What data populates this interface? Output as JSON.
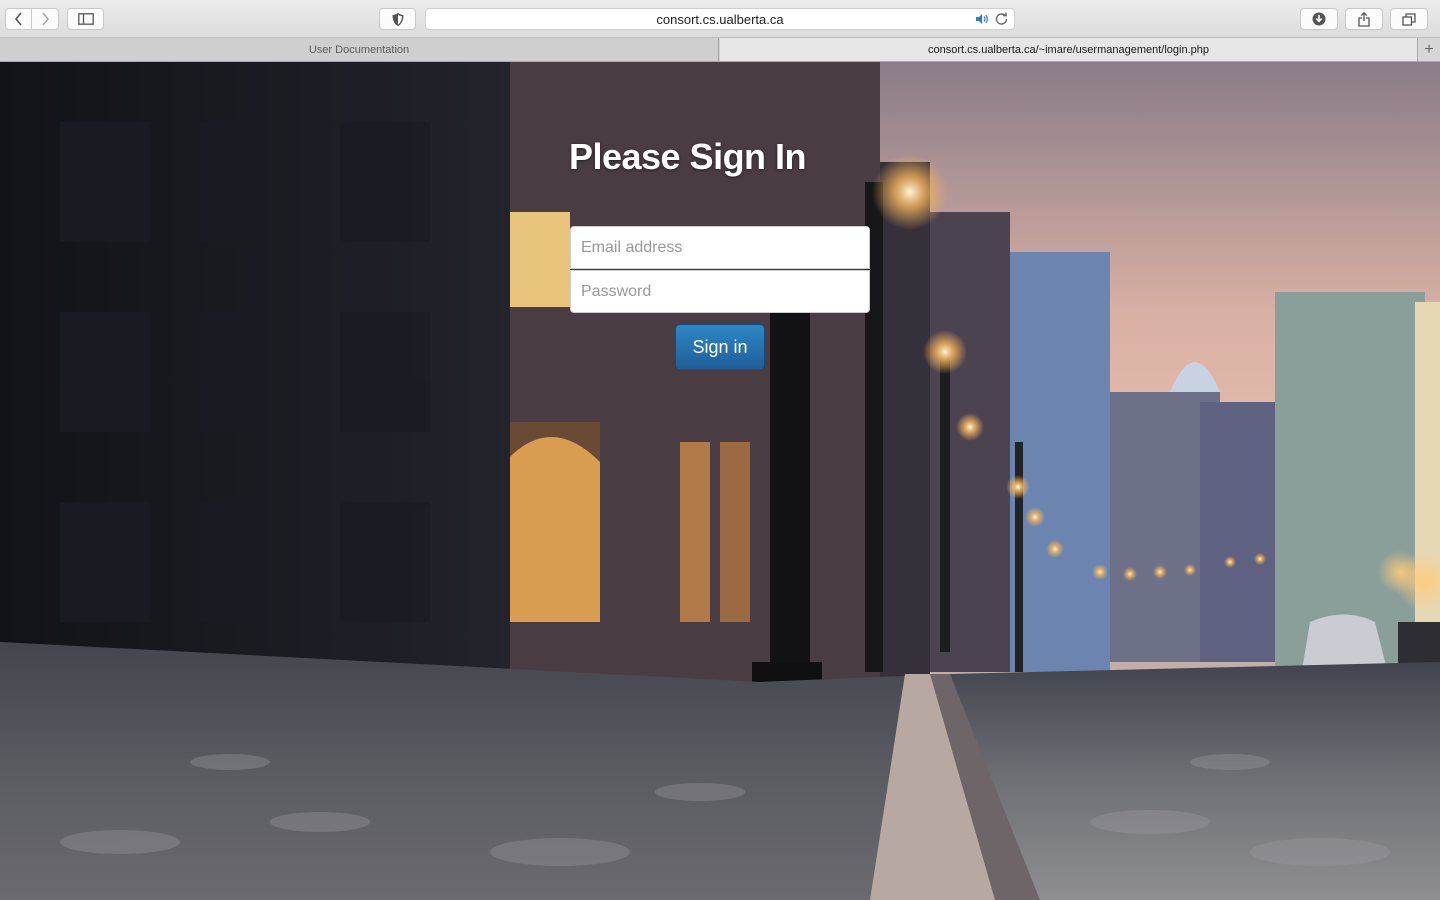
{
  "browser": {
    "address": "consort.cs.ualberta.ca",
    "tabs": [
      {
        "label": "User Documentation",
        "active": false
      },
      {
        "label": "consort.cs.ualberta.ca/~imare/usermanagement/login.php",
        "active": true
      }
    ],
    "new_tab_glyph": "+"
  },
  "login": {
    "title": "Please Sign In",
    "email_placeholder": "Email address",
    "password_placeholder": "Password",
    "email_value": "",
    "password_value": "",
    "submit_label": "Sign in"
  },
  "colors": {
    "button_top": "#2e86c7",
    "button_bottom": "#1f5f98",
    "title": "#ffffff"
  }
}
